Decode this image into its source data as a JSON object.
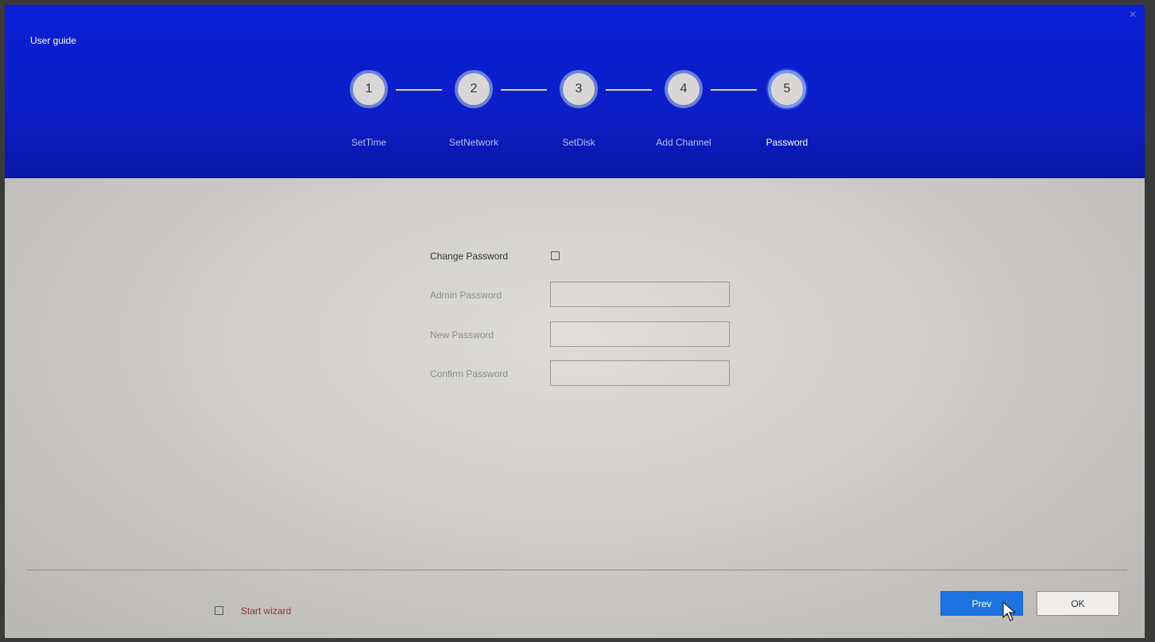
{
  "window": {
    "title": "User guide",
    "close_icon": "close-icon"
  },
  "steps": [
    {
      "number": "1",
      "label": "SetTime",
      "active": false
    },
    {
      "number": "2",
      "label": "SetNetwork",
      "active": false
    },
    {
      "number": "3",
      "label": "SetDisk",
      "active": false
    },
    {
      "number": "4",
      "label": "Add Channel",
      "active": false
    },
    {
      "number": "5",
      "label": "Password",
      "active": true
    }
  ],
  "form": {
    "change_password_label": "Change Password",
    "change_password_checked": false,
    "admin_password_label": "Admin Password",
    "admin_password_value": "",
    "new_password_label": "New Password",
    "new_password_value": "",
    "confirm_password_label": "Confirm Password",
    "confirm_password_value": ""
  },
  "footer": {
    "start_wizard_label": "Start wizard",
    "start_wizard_checked": false,
    "prev_label": "Prev",
    "ok_label": "OK"
  },
  "colors": {
    "header_bg": "#0a1fd6",
    "primary_button": "#1d73df",
    "wizard_label": "#8b3a2a"
  }
}
